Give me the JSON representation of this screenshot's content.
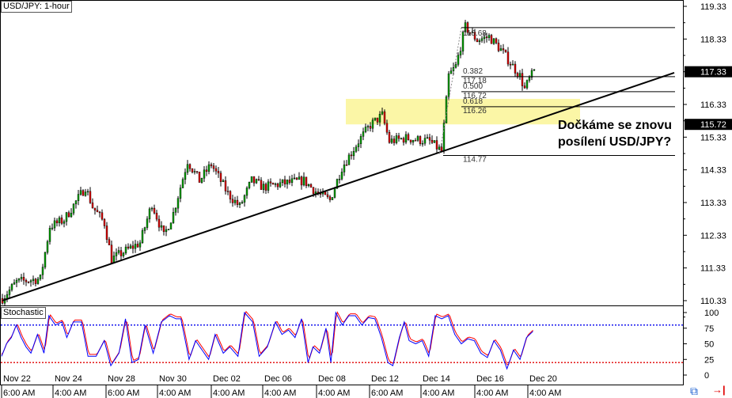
{
  "chart_data": {
    "type": "candlestick",
    "title": "USD/JPY: 1-hour",
    "symbol": "USD/JPY",
    "price_axis": {
      "ticks": [
        "119.33",
        "118.33",
        "117.33",
        "116.33",
        "115.33",
        "114.33",
        "113.33",
        "112.33",
        "111.33",
        "110.33"
      ],
      "range": [
        110.33,
        119.33
      ]
    },
    "current_price": "117.33",
    "marker_price": "115.72",
    "price_keypoints": [
      [
        0,
        110.4
      ],
      [
        6,
        110.9
      ],
      [
        16,
        111.0
      ],
      [
        20,
        112.6
      ],
      [
        26,
        112.8
      ],
      [
        35,
        113.8
      ],
      [
        38,
        113.2
      ],
      [
        43,
        112.7
      ],
      [
        46,
        111.6
      ],
      [
        53,
        111.9
      ],
      [
        58,
        112.1
      ],
      [
        63,
        113.3
      ],
      [
        68,
        112.3
      ],
      [
        72,
        113.0
      ],
      [
        78,
        114.6
      ],
      [
        83,
        114.0
      ],
      [
        88,
        114.5
      ],
      [
        95,
        113.6
      ],
      [
        100,
        113.2
      ],
      [
        105,
        114.0
      ],
      [
        110,
        113.8
      ],
      [
        117,
        113.9
      ],
      [
        127,
        114.0
      ],
      [
        133,
        113.6
      ],
      [
        138,
        113.4
      ],
      [
        143,
        114.4
      ],
      [
        150,
        115.2
      ],
      [
        155,
        115.7
      ],
      [
        160,
        116.0
      ],
      [
        163,
        115.2
      ],
      [
        170,
        115.3
      ],
      [
        180,
        115.2
      ],
      [
        185,
        114.9
      ],
      [
        188,
        117.2
      ],
      [
        191,
        117.5
      ],
      [
        195,
        118.7
      ],
      [
        200,
        118.3
      ],
      [
        205,
        118.4
      ],
      [
        210,
        118.0
      ],
      [
        213,
        117.7
      ],
      [
        218,
        117.2
      ],
      [
        220,
        116.8
      ],
      [
        222,
        117.1
      ],
      [
        224,
        117.35
      ]
    ],
    "trendline": [
      [
        0,
        110.33
      ],
      [
        283,
        117.3
      ]
    ],
    "fibonacci": [
      {
        "ratio": "",
        "price": "118.68"
      },
      {
        "ratio": "0.382",
        "price": "117.18"
      },
      {
        "ratio": "0.500",
        "price": "116.72"
      },
      {
        "ratio": "0.618",
        "price": "116.26"
      },
      {
        "ratio": "",
        "price": "114.77"
      }
    ],
    "zone": {
      "from_price": 115.72,
      "to_price": 116.4
    },
    "annotation": [
      "Dočkáme se znovu",
      "posílení USD/JPY?"
    ],
    "stochastic": {
      "label": "Stochastic",
      "ticks": [
        "100",
        "75",
        "50",
        "25",
        "0"
      ],
      "levels": [
        80,
        20
      ],
      "k_keypoints": [
        [
          0,
          30
        ],
        [
          3,
          50
        ],
        [
          6,
          60
        ],
        [
          9,
          80
        ],
        [
          12,
          60
        ],
        [
          15,
          45
        ],
        [
          18,
          35
        ],
        [
          22,
          65
        ],
        [
          26,
          35
        ],
        [
          29,
          95
        ],
        [
          33,
          80
        ],
        [
          37,
          85
        ],
        [
          40,
          60
        ],
        [
          44,
          85
        ],
        [
          49,
          85
        ],
        [
          53,
          30
        ],
        [
          58,
          30
        ],
        [
          63,
          55
        ],
        [
          67,
          15
        ],
        [
          72,
          35
        ],
        [
          76,
          90
        ],
        [
          80,
          20
        ],
        [
          84,
          25
        ],
        [
          88,
          80
        ],
        [
          93,
          35
        ],
        [
          98,
          85
        ],
        [
          103,
          95
        ],
        [
          107,
          90
        ],
        [
          110,
          90
        ],
        [
          115,
          25
        ],
        [
          119,
          55
        ],
        [
          123,
          40
        ],
        [
          127,
          25
        ],
        [
          131,
          65
        ],
        [
          136,
          35
        ],
        [
          140,
          45
        ],
        [
          145,
          30
        ],
        [
          149,
          100
        ],
        [
          154,
          85
        ],
        [
          158,
          30
        ],
        [
          163,
          45
        ],
        [
          168,
          85
        ],
        [
          172,
          65
        ],
        [
          176,
          72
        ],
        [
          180,
          60
        ],
        [
          184,
          90
        ],
        [
          188,
          20
        ],
        [
          191,
          45
        ],
        [
          195,
          35
        ],
        [
          199,
          75
        ],
        [
          202,
          20
        ],
        [
          205,
          100
        ],
        [
          209,
          80
        ],
        [
          213,
          95
        ],
        [
          217,
          95
        ],
        [
          221,
          80
        ],
        [
          225,
          92
        ],
        [
          229,
          90
        ],
        [
          233,
          60
        ],
        [
          237,
          20
        ],
        [
          240,
          15
        ],
        [
          244,
          60
        ],
        [
          247,
          85
        ],
        [
          250,
          55
        ],
        [
          254,
          50
        ],
        [
          258,
          55
        ],
        [
          262,
          30
        ],
        [
          266,
          95
        ],
        [
          270,
          90
        ],
        [
          274,
          95
        ],
        [
          278,
          65
        ],
        [
          282,
          50
        ],
        [
          286,
          58
        ],
        [
          290,
          55
        ],
        [
          294,
          35
        ],
        [
          298,
          28
        ],
        [
          302,
          55
        ],
        [
          306,
          40
        ],
        [
          310,
          10
        ],
        [
          314,
          40
        ],
        [
          318,
          25
        ],
        [
          322,
          60
        ],
        [
          326,
          70
        ]
      ],
      "k_color": "#0000ff",
      "d_color": "#ff0000"
    },
    "x_axis": {
      "dates": [
        "Nov 22",
        "Nov 24",
        "Nov 28",
        "Nov 30",
        "Dec 02",
        "Dec 06",
        "Dec 08",
        "Dec 12",
        "Dec 14",
        "Dec 16",
        "Dec 20"
      ],
      "times": [
        "6:00 AM",
        "4:00 AM",
        "6:00 AM",
        "4:00 AM",
        "4:00 AM",
        "4:00 AM",
        "4:00 AM",
        "6:00 AM",
        "4:00 AM",
        "4:00 AM",
        "4:00 AM"
      ]
    },
    "colors": {
      "up": "#00a000",
      "down": "#e00000",
      "zone": "#fbf6a6"
    }
  }
}
